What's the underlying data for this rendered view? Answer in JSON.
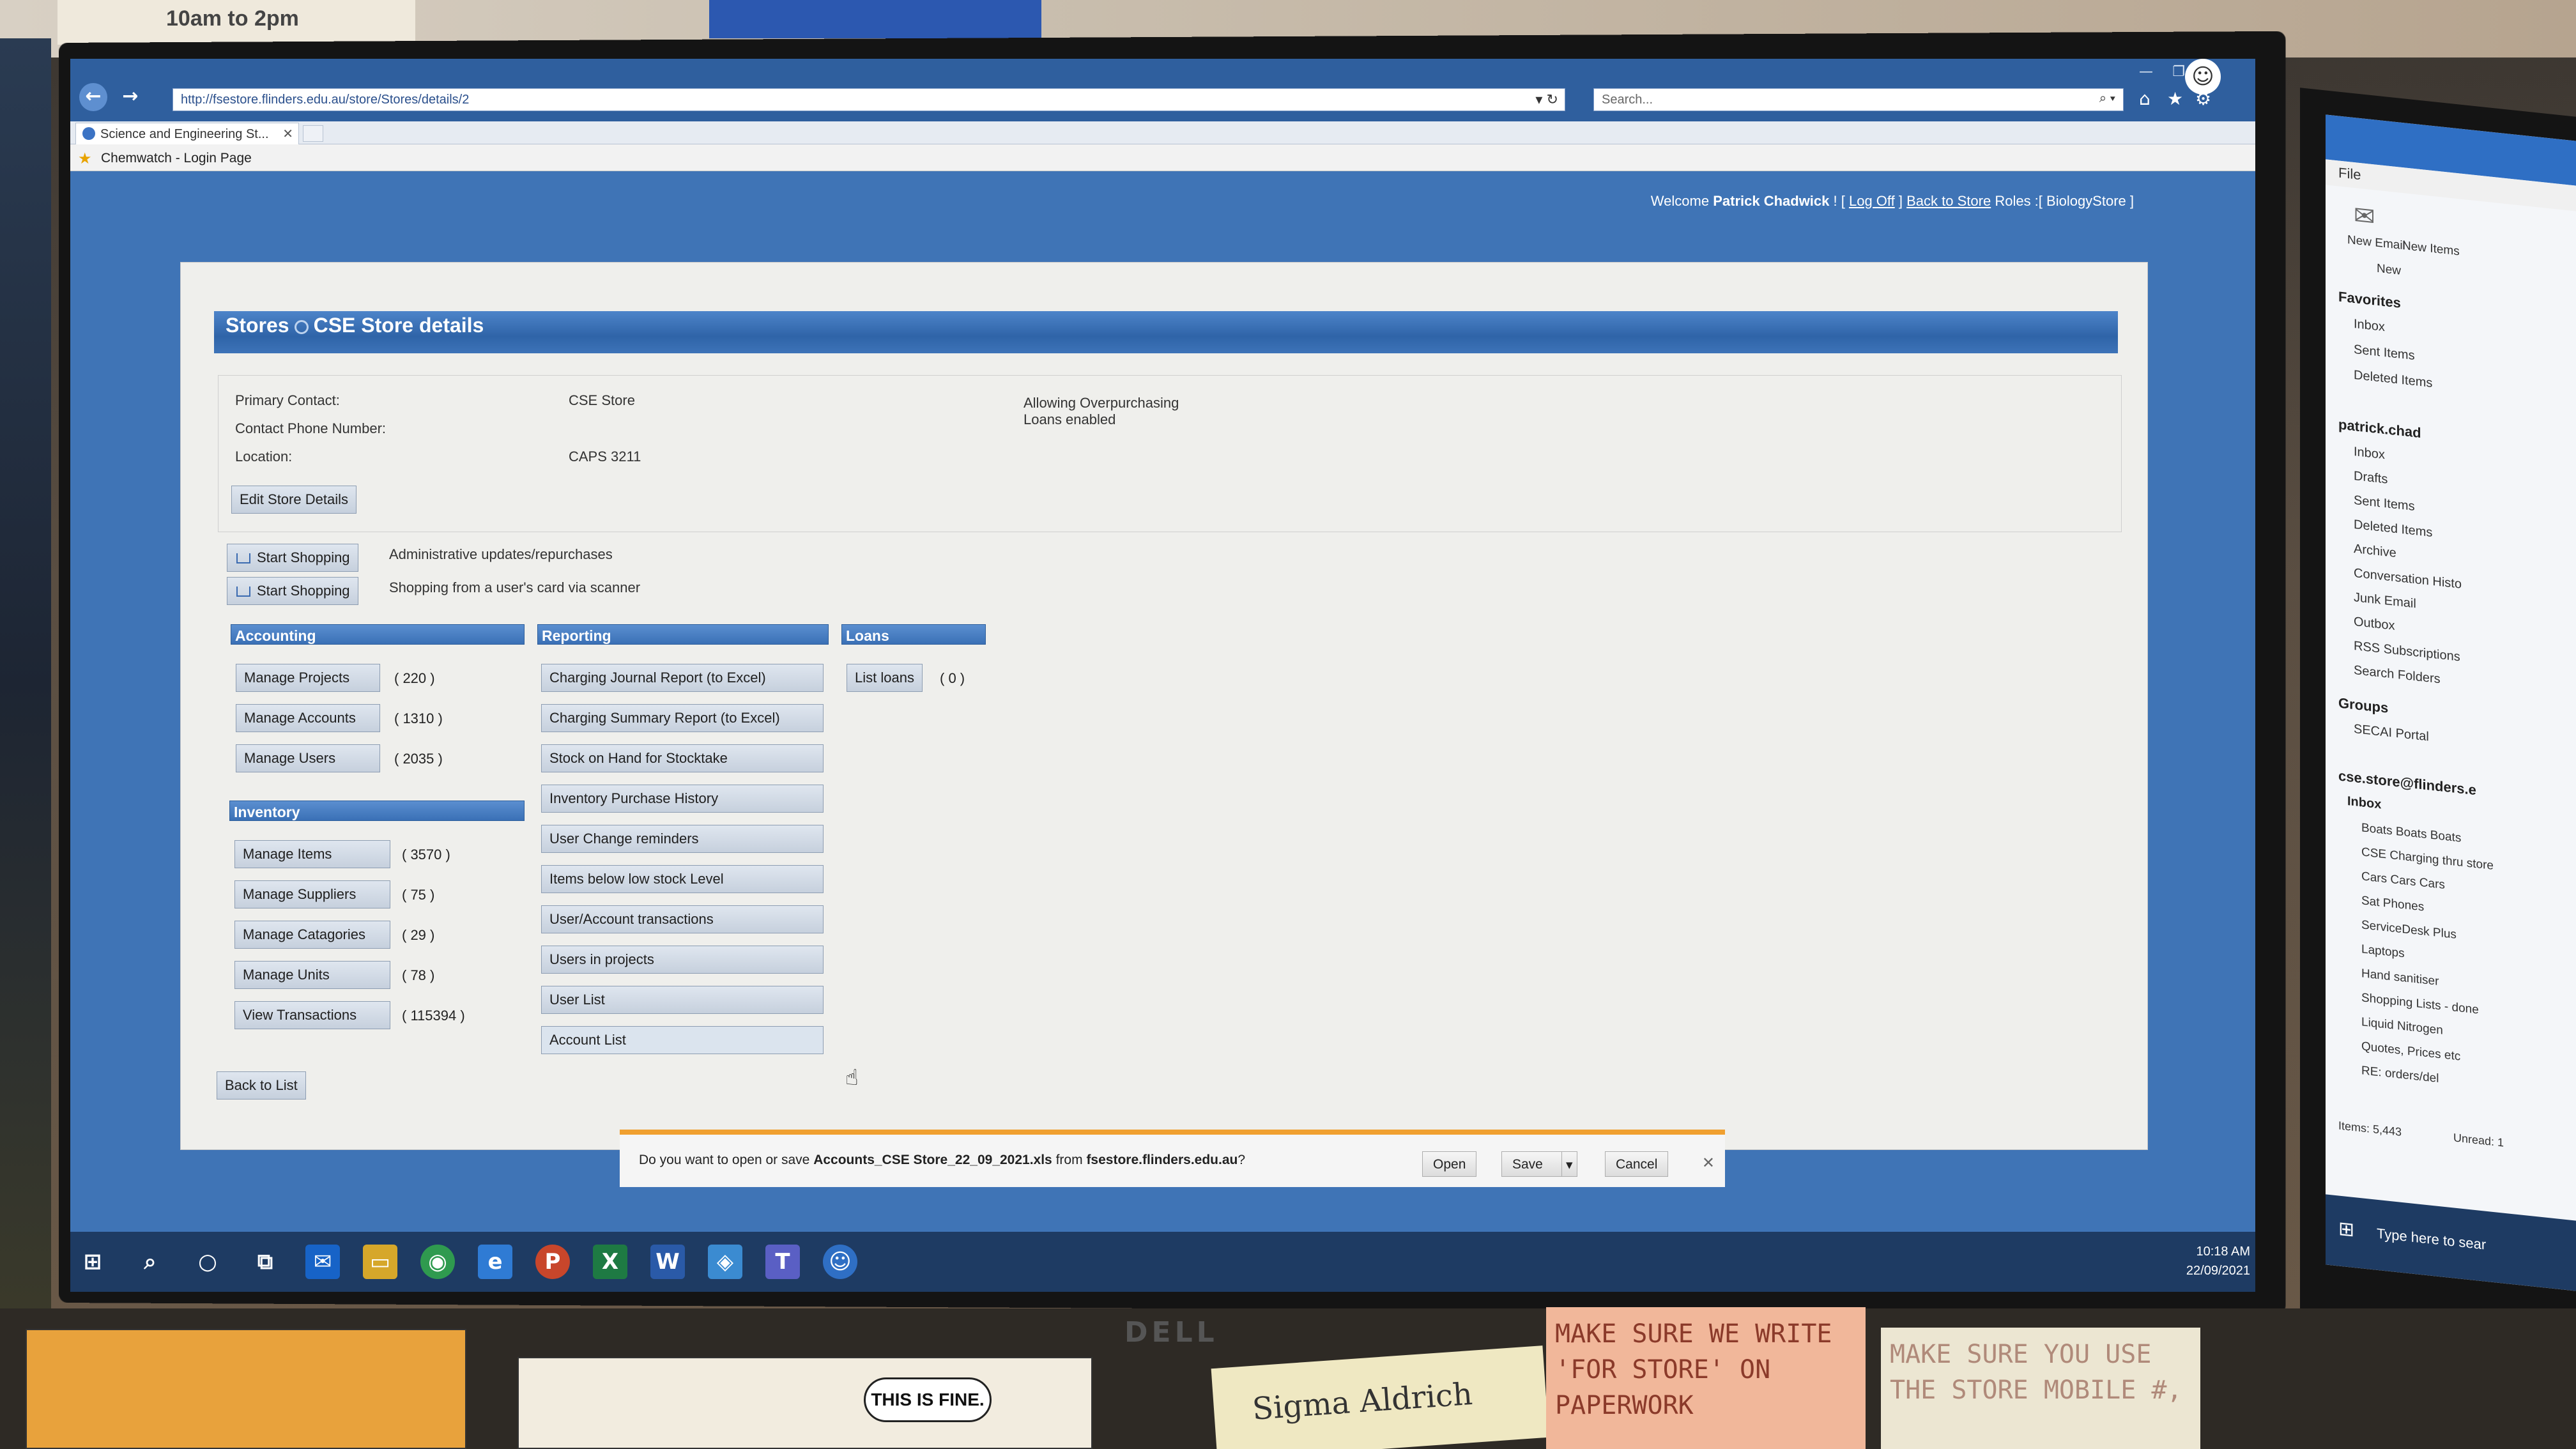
{
  "environment": {
    "wall_note": "10am to  2pm",
    "sticky_note_1": "MAKE SURE WE WRITE 'FOR STORE' ON PAPERWORK",
    "sticky_note_2": "MAKE SURE YOU USE THE STORE MOBILE #,",
    "sticky_note_3": "Sigma Aldrich",
    "comic_text": "THIS IS FINE.",
    "monitor_brand": "DELL"
  },
  "browser": {
    "url": "http://fsestore.flinders.edu.au/store/Stores/details/2",
    "search_placeholder": "Search...",
    "tab_title": "Science and Engineering St...",
    "favorite_link": "Chemwatch - Login Page"
  },
  "header": {
    "welcome_prefix": "Welcome",
    "user_name": "Patrick Chadwick",
    "welcome_sep1": "! [",
    "log_off": "Log Off",
    "welcome_sep2": "]",
    "back_to_store": "Back to Store",
    "roles_text": "Roles :[ BiologyStore ]"
  },
  "page": {
    "breadcrumb_root": "Stores",
    "breadcrumb_current": "CSE Store details"
  },
  "details": {
    "primary_contact_label": "Primary Contact:",
    "primary_contact_value": "CSE Store",
    "phone_label": "Contact Phone Number:",
    "location_label": "Location:",
    "location_value": "CAPS 3211",
    "flag_overpurchasing": "Allowing Overpurchasing",
    "flag_loans": "Loans enabled",
    "edit_button": "Edit Store Details"
  },
  "shopping": [
    {
      "label": "Start Shopping",
      "desc": "Administrative updates/repurchases"
    },
    {
      "label": "Start Shopping",
      "desc": "Shopping from a user's card via scanner"
    }
  ],
  "accounting": {
    "title": "Accounting",
    "items": [
      {
        "label": "Manage Projects",
        "count": "( 220 )"
      },
      {
        "label": "Manage Accounts",
        "count": "( 1310 )"
      },
      {
        "label": "Manage Users",
        "count": "( 2035 )"
      }
    ]
  },
  "inventory": {
    "title": "Inventory",
    "items": [
      {
        "label": "Manage Items",
        "count": "( 3570 )"
      },
      {
        "label": "Manage Suppliers",
        "count": "( 75 )"
      },
      {
        "label": "Manage Catagories",
        "count": "( 29 )"
      },
      {
        "label": "Manage Units",
        "count": "( 78 )"
      },
      {
        "label": "View Transactions",
        "count": "( 115394 )"
      }
    ]
  },
  "reporting": {
    "title": "Reporting",
    "items": [
      "Charging Journal Report (to Excel)",
      "Charging Summary Report (to Excel)",
      "Stock on Hand for Stocktake",
      "Inventory Purchase History",
      "User Change reminders",
      "Items below low stock Level",
      "User/Account transactions",
      "Users in projects",
      "User List",
      "Account List"
    ]
  },
  "loans": {
    "title": "Loans",
    "item": "List loans",
    "count": "( 0 )"
  },
  "back_button": "Back to List",
  "download": {
    "prefix": "Do you want to open or save",
    "filename": "Accounts_CSE Store_22_09_2021.xls",
    "from_text": "from",
    "site": "fsestore.flinders.edu.au",
    "suffix": "?",
    "open": "Open",
    "save": "Save",
    "cancel": "Cancel"
  },
  "taskbar": {
    "time": "10:18 AM",
    "date": "22/09/2021"
  },
  "outlook": {
    "file": "File",
    "new_email": "New Email",
    "new_items": "New Items",
    "new_group": "New",
    "favorites": "Favorites",
    "fav_items": [
      "Inbox",
      "Sent Items",
      "Deleted Items"
    ],
    "account1": "patrick.chad",
    "acc1_items": [
      "Inbox",
      "Drafts",
      "Sent Items",
      "Deleted Items",
      "Archive",
      "Conversation Histo",
      "Junk Email",
      "Outbox",
      "RSS Subscriptions",
      "Search Folders"
    ],
    "groups": "Groups",
    "group_items": [
      "SECAI Portal"
    ],
    "account2": "cse.store@flinders.e",
    "inbox": "Inbox",
    "inbox_items": [
      "Boats Boats Boats",
      "CSE Charging thru store",
      "Cars Cars Cars",
      "Sat Phones",
      "ServiceDesk Plus",
      "Laptops",
      "Hand sanitiser",
      "Shopping Lists - done",
      "Liquid Nitrogen",
      "Quotes, Prices etc",
      "RE: orders/del"
    ],
    "items_count": "Items: 5,443",
    "unread": "Unread: 1",
    "search_placeholder": "Type here to sear"
  }
}
